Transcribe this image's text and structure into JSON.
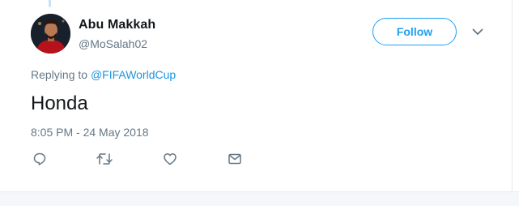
{
  "tweet": {
    "author": {
      "display_name": "Abu Makkah",
      "handle": "@MoSalah02"
    },
    "follow_label": "Follow",
    "replying_prefix": "Replying to ",
    "replying_to": "@FIFAWorldCup",
    "text": "Honda",
    "timestamp": "8:05 PM - 24 May 2018"
  },
  "icons": {
    "more": "chevron-down-icon",
    "reply": "reply-icon",
    "retweet": "retweet-icon",
    "like": "heart-icon",
    "dm": "envelope-icon"
  },
  "colors": {
    "accent": "#1da1f2",
    "link": "#1b95e0",
    "muted": "#657786",
    "text": "#14171a"
  }
}
